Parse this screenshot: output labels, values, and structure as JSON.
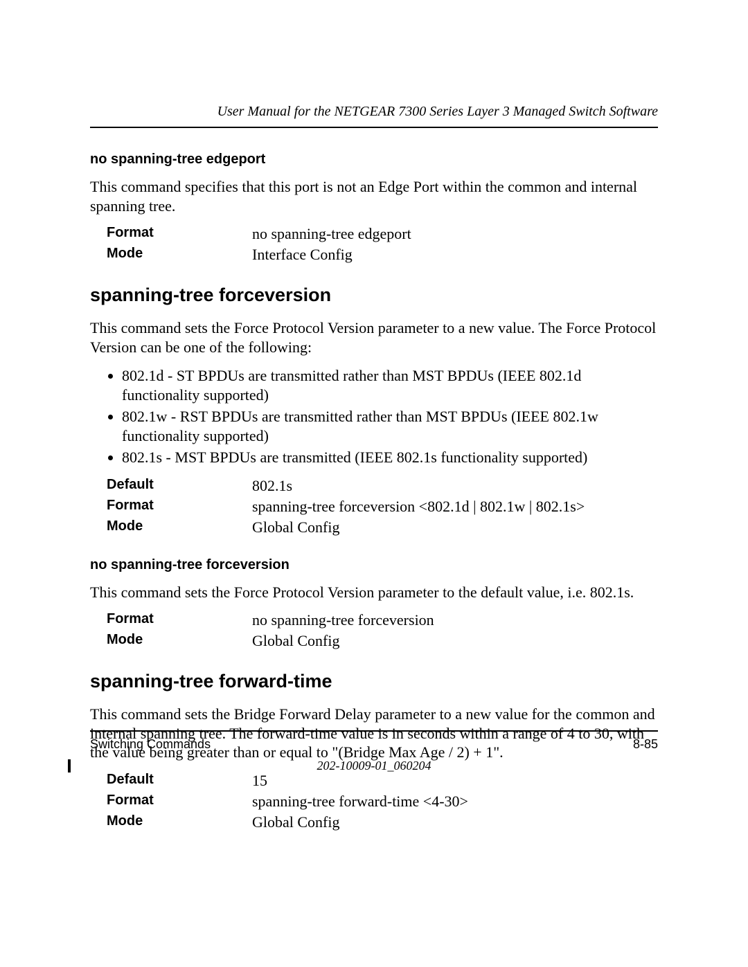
{
  "header": {
    "title": "User Manual for the NETGEAR 7300 Series Layer 3 Managed Switch Software"
  },
  "sec1": {
    "sub_h": "no spanning-tree edgeport",
    "body": "This command specifies that this port is not an Edge Port within the common and internal spanning tree.",
    "rows": {
      "format_l": "Format",
      "format_v": "no spanning-tree edgeport",
      "mode_l": "Mode",
      "mode_v": "Interface Config"
    }
  },
  "sec2": {
    "h": "spanning-tree forceversion",
    "body": "This command sets the Force Protocol Version parameter to a new value. The Force Protocol Version can be one of the following:",
    "li1": "802.1d - ST BPDUs are transmitted rather than MST BPDUs (IEEE 802.1d functionality supported)",
    "li2": "802.1w - RST BPDUs are transmitted rather than MST BPDUs (IEEE 802.1w functionality supported)",
    "li3": "802.1s - MST BPDUs are transmitted (IEEE 802.1s functionality supported)",
    "rows": {
      "default_l": "Default",
      "default_v": "802.1s",
      "format_l": "Format",
      "format_v": "spanning-tree forceversion <802.1d | 802.1w | 802.1s>",
      "mode_l": "Mode",
      "mode_v": "Global Config"
    }
  },
  "sec3": {
    "sub_h": "no spanning-tree forceversion",
    "body": "This command sets the Force Protocol Version parameter to the default value, i.e. 802.1s.",
    "rows": {
      "format_l": "Format",
      "format_v": "no spanning-tree forceversion",
      "mode_l": "Mode",
      "mode_v": "Global Config"
    }
  },
  "sec4": {
    "h": "spanning-tree forward-time",
    "body": "This command sets the Bridge Forward Delay parameter to a new value for the common and internal spanning tree. The forward-time value is in seconds within a range of 4 to 30, with the value being greater than or equal to \"(Bridge Max Age / 2) + 1\".",
    "rows": {
      "default_l": "Default",
      "default_v": "15",
      "format_l": "Format",
      "format_v": "spanning-tree forward-time <4-30>",
      "mode_l": "Mode",
      "mode_v": "Global Config"
    }
  },
  "footer": {
    "left": "Switching Commands",
    "right": "8-85",
    "docnum": "202-10009-01_060204"
  }
}
